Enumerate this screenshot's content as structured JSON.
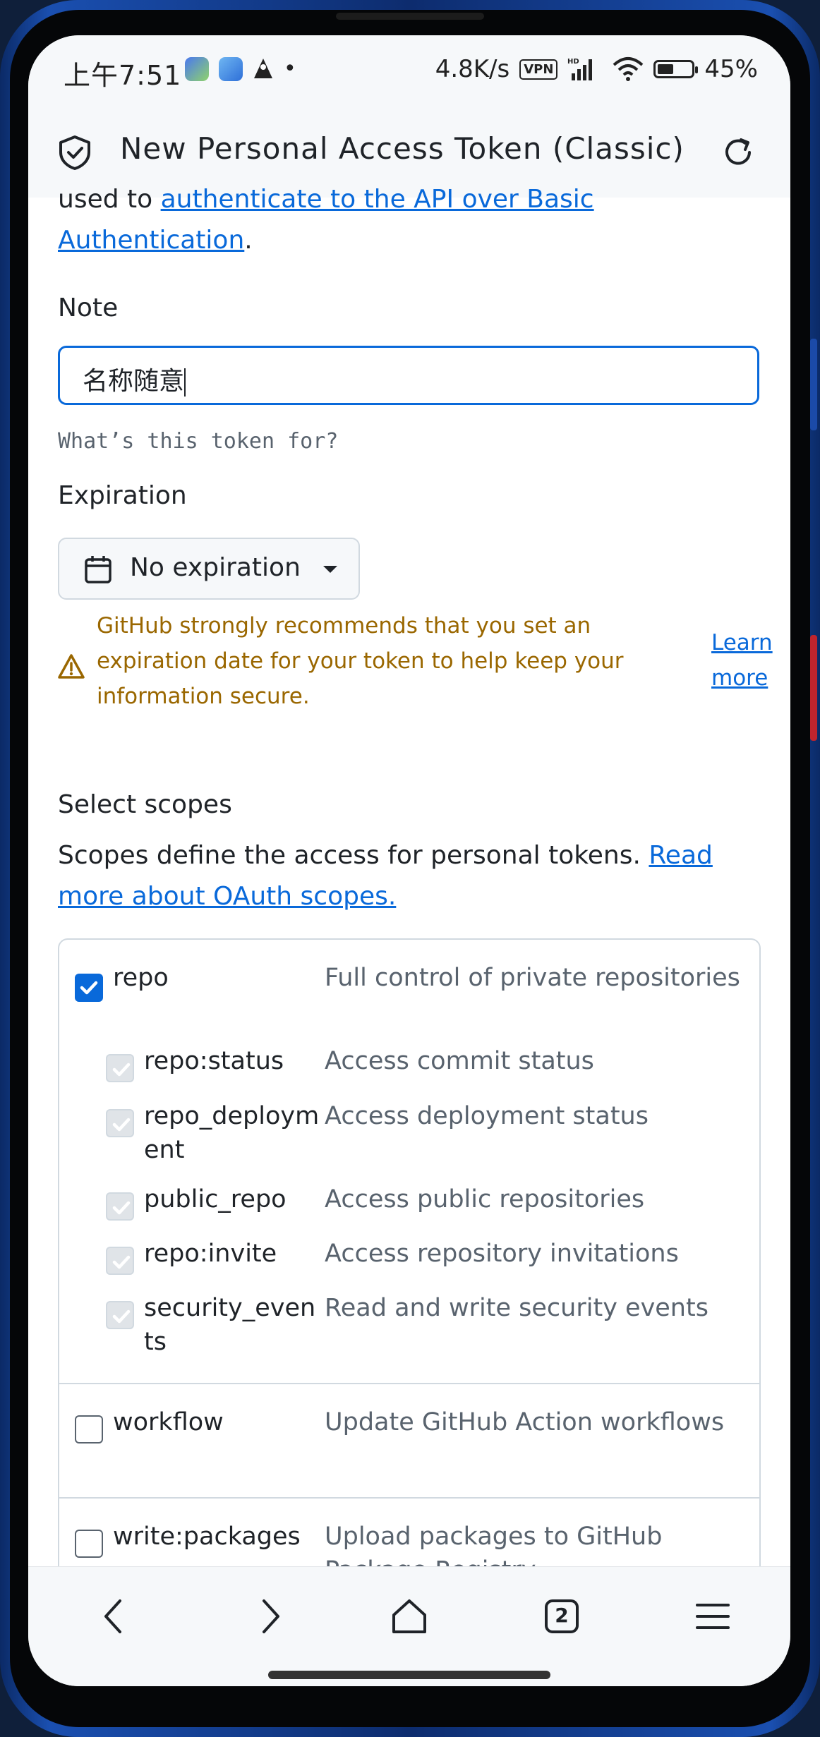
{
  "status_bar": {
    "time": "上午7:51",
    "net_speed": "4.8K/s",
    "vpn_badge": "VPN",
    "hd_badge": "HD",
    "battery": "45%"
  },
  "header": {
    "title": "New Personal Access Token (Classic)"
  },
  "intro": {
    "prefix": "used to ",
    "link_text": "authenticate to the API over Basic Authentication",
    "suffix": "."
  },
  "note": {
    "label": "Note",
    "value": "名称随意",
    "hint": "What’s this token for?"
  },
  "expiration": {
    "label": "Expiration",
    "selected": "No expiration",
    "warning": "GitHub strongly recommends that you set an expiration date for your token to help keep your information secure.",
    "learn_more": "Learn more"
  },
  "scopes": {
    "heading": "Select scopes",
    "description": "Scopes define the access for personal tokens.",
    "link_text": "Read more about OAuth scopes.",
    "items": [
      {
        "name": "repo",
        "desc": "Full control of private repositories",
        "state": "checked"
      },
      {
        "name": "repo:status",
        "desc": "Access commit status",
        "state": "disabled"
      },
      {
        "name": "repo_deployment",
        "desc": "Access deployment status",
        "state": "disabled"
      },
      {
        "name": "public_repo",
        "desc": "Access public repositories",
        "state": "disabled"
      },
      {
        "name": "repo:invite",
        "desc": "Access repository invitations",
        "state": "disabled"
      },
      {
        "name": "security_events",
        "desc": "Read and write security events",
        "state": "disabled"
      },
      {
        "name": "workflow",
        "desc": "Update GitHub Action workflows",
        "state": "unchecked"
      },
      {
        "name": "write:packages",
        "desc": "Upload packages to GitHub Package Registry",
        "state": "unchecked"
      }
    ]
  },
  "colors": {
    "accent": "#0969da",
    "warning": "#9a6700",
    "text": "#1f2328",
    "muted": "#59636e",
    "frame": "#1a4fb0"
  },
  "icons": {
    "header_left": "shield-check-icon",
    "header_right": "reload-icon",
    "nav": [
      "back-icon",
      "forward-icon",
      "home-icon",
      "tabs-icon",
      "menu-icon"
    ]
  },
  "bottom_nav": {
    "tabs_count": "2"
  }
}
